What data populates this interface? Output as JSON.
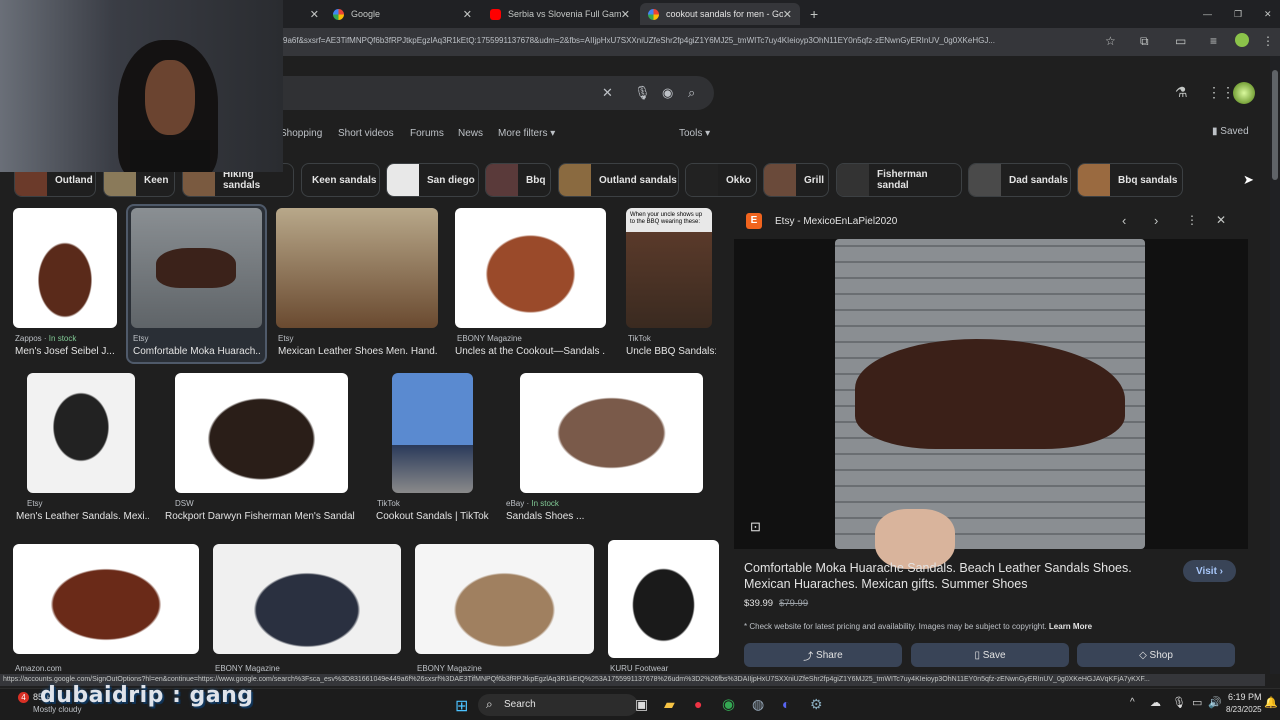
{
  "tabs": [
    {
      "title": "",
      "icon": "tab-close-icon"
    },
    {
      "title": "Google",
      "icon": "google-icon"
    },
    {
      "title": "Serbia vs Slovenia Full Game Hi",
      "icon": "youtube-icon"
    },
    {
      "title": "cookout sandals for men - Goo",
      "icon": "google-icon"
    }
  ],
  "address": {
    "url": "9a6f&sxsrf=AE3TifMNPQf6b3fRPJtkpEgzlAq3R1kEtQ:1755991137678&udm=2&fbs=AIIjpHxU7SXXniUZfeShr2fp4giZ1Y6MJ25_tmWITc7uy4KIeioyp3OhN11EY0n5qfz-zENwnGyERInUV_0g0XKeHGJ..."
  },
  "nav": {
    "shopping": "Shopping",
    "short_videos": "Short videos",
    "forums": "Forums",
    "news": "News",
    "more_filters": "More filters",
    "tools": "Tools",
    "saved": "Saved"
  },
  "chips": [
    "Outland",
    "Keen",
    "Hiking sandals",
    "Keen sandals",
    "San diego",
    "Bbq",
    "Outland sandals",
    "Okko",
    "Grill",
    "Fisherman sandal",
    "Dad sandals",
    "Bbq sandals"
  ],
  "results": [
    {
      "source": "Zappos",
      "stock": "In stock",
      "title": "Men's Josef Seibel J..."
    },
    {
      "source": "Etsy",
      "stock": "",
      "title": "Comfortable Moka Huarach..."
    },
    {
      "source": "Etsy",
      "stock": "",
      "title": "Mexican Leather Shoes Men. Hand..."
    },
    {
      "source": "EBONY Magazine",
      "stock": "",
      "title": "Uncles at the Cookout—Sandals ..."
    },
    {
      "source": "TikTok",
      "stock": "",
      "title": "Uncle BBQ Sandals:..."
    },
    {
      "source": "Etsy",
      "stock": "",
      "title": "Men's Leather Sandals. Mexi..."
    },
    {
      "source": "DSW",
      "stock": "",
      "title": "Rockport Darwyn Fisherman Men's Sandal -..."
    },
    {
      "source": "TikTok",
      "stock": "",
      "title": "Cookout Sandals | TikTok"
    },
    {
      "source": "eBay",
      "stock": "In stock",
      "title": "Sandals Shoes ..."
    },
    {
      "source": "Amazon.com",
      "stock": "",
      "title": ""
    },
    {
      "source": "EBONY Magazine",
      "stock": "",
      "title": ""
    },
    {
      "source": "EBONY Magazine",
      "stock": "",
      "title": ""
    },
    {
      "source": "KURU Footwear",
      "stock": "",
      "title": ""
    }
  ],
  "tiktok_caption": "When your uncle shows up to the BBQ wearing these:",
  "panel": {
    "source": "Etsy - MexicoEnLaPiel2020",
    "title": "Comfortable Moka Huarache Sandals. Beach Leather Sandals Shoes. Mexican Huaraches. Mexican gifts. Summer Shoes",
    "visit": "Visit",
    "price": "$39.99",
    "old_price": "$79.99",
    "notice": "* Check website for latest pricing and availability. Images may be subject to copyright.",
    "learn_more": "Learn More",
    "share": "Share",
    "save": "Save",
    "shop": "Shop"
  },
  "status_url": "https://accounts.google.com/SignOutOptions?hl=en&continue=https://www.google.com/search%3Fsca_esv%3D831661049e449a6f%26sxsrf%3DAE3TifMNPQf6b3fRPJtkpEgzlAq3R1kEtQ%253A1755991137678%26udm%3D2%26fbs%3DAIIjpHxU7SXXniUZfeShr2fp4giZ1Y6MJ25_tmWITc7uy4KIeioyp3OhN11EY0n5qfz-zENwnGyERInUV_0g0XKeHGJAVqKFjA7yKXF...",
  "taskbar": {
    "weather_temp": "85°F",
    "weather_desc": "Mostly cloudy",
    "search": "Search",
    "time": "6:19 PM",
    "date": "8/23/2025",
    "badge": "4"
  },
  "overlay": "dubaidrip : gang",
  "colors": {
    "accent": "#a8c7fa",
    "instock": "#81c995",
    "bg": "#1f1f1f"
  }
}
